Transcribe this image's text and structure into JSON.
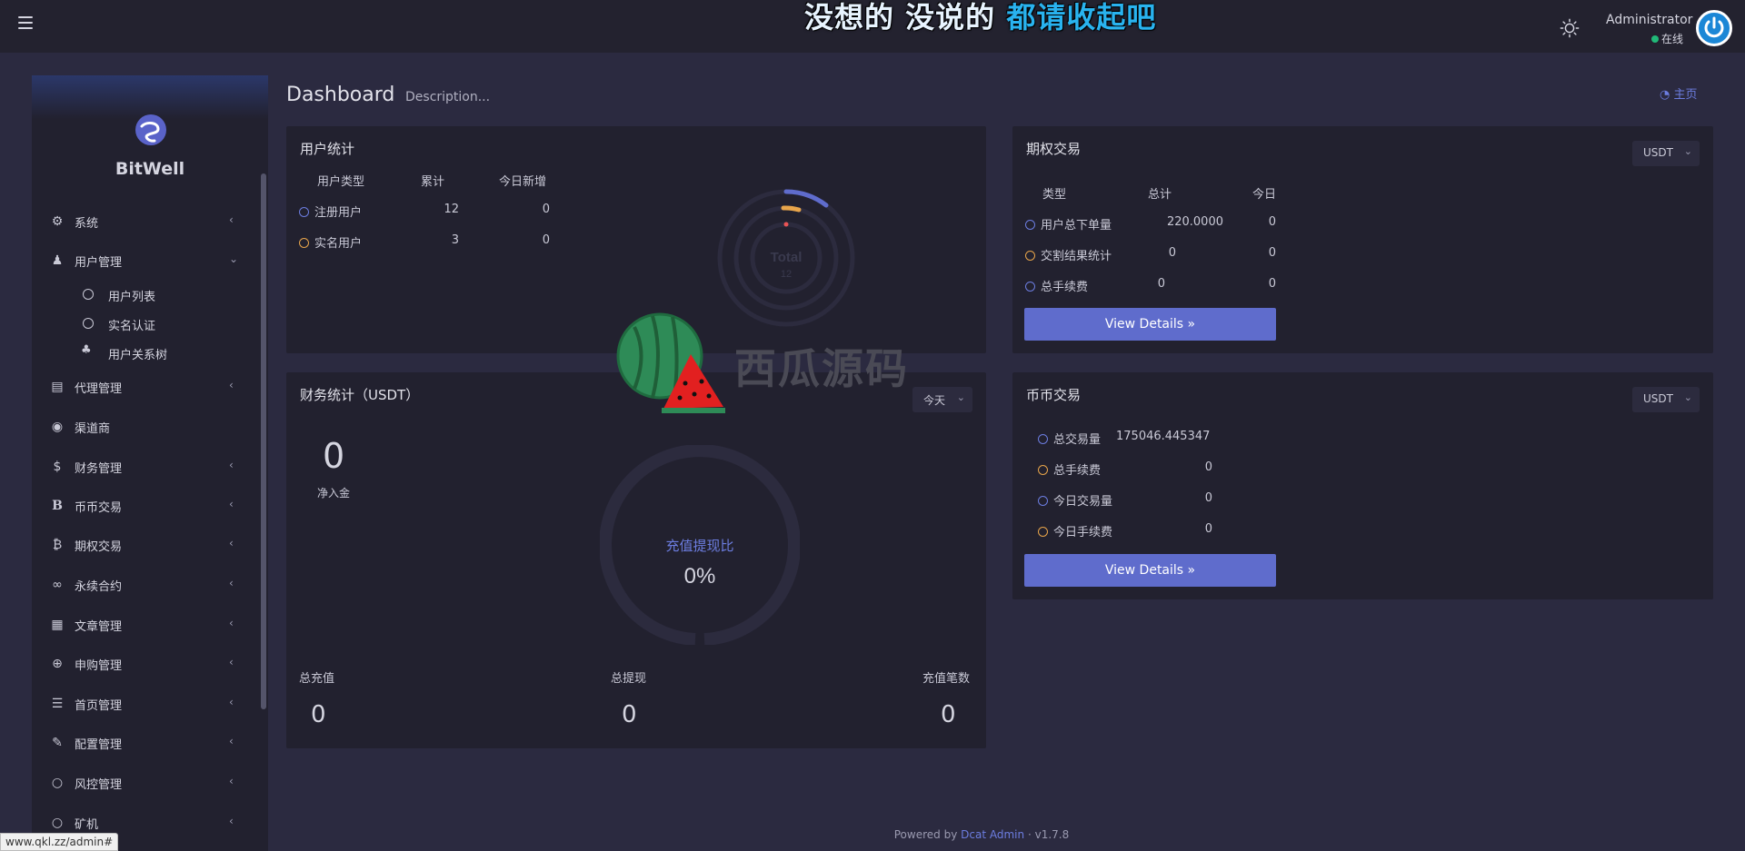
{
  "slogan": {
    "part1": "没想的",
    "part2": "没说的",
    "part3": "都请收起吧"
  },
  "header": {
    "user_name": "Administrator",
    "user_status": "在线"
  },
  "sidebar": {
    "brand": "BitWell",
    "items": [
      {
        "label": "系统",
        "icon": "gear-icon",
        "arrow": "‹"
      },
      {
        "label": "用户管理",
        "icon": "users-icon",
        "arrow": "⌄"
      },
      {
        "label": "代理管理",
        "icon": "id-card-icon",
        "arrow": "‹"
      },
      {
        "label": "渠道商",
        "icon": "user-circle-icon",
        "arrow": ""
      },
      {
        "label": "财务管理",
        "icon": "dollar-icon",
        "arrow": "‹"
      },
      {
        "label": "币币交易",
        "icon": "b-letter-icon",
        "arrow": "‹"
      },
      {
        "label": "期权交易",
        "icon": "bitcoin-icon",
        "arrow": "‹"
      },
      {
        "label": "永续合约",
        "icon": "link-icon",
        "arrow": "‹"
      },
      {
        "label": "文章管理",
        "icon": "newspaper-icon",
        "arrow": "‹"
      },
      {
        "label": "申购管理",
        "icon": "lifebuoy-icon",
        "arrow": "‹"
      },
      {
        "label": "首页管理",
        "icon": "list-icon",
        "arrow": "‹"
      },
      {
        "label": "配置管理",
        "icon": "wrench-icon",
        "arrow": "‹"
      },
      {
        "label": "风控管理",
        "icon": "circle-icon",
        "arrow": "‹"
      },
      {
        "label": "矿机",
        "icon": "circle-icon",
        "arrow": "‹"
      }
    ],
    "subitems": [
      {
        "label": "用户列表"
      },
      {
        "label": "实名认证"
      },
      {
        "label": "用户关系树"
      }
    ]
  },
  "page": {
    "title": "Dashboard",
    "description": "Description...",
    "home_link": "主页"
  },
  "user_stats": {
    "title": "用户统计",
    "headers": [
      "用户类型",
      "累计",
      "今日新增"
    ],
    "rows": [
      {
        "label": "注册用户",
        "total": "12",
        "today": "0"
      },
      {
        "label": "实名用户",
        "total": "3",
        "today": "0"
      }
    ],
    "donut_label": "Total",
    "donut_value": "12"
  },
  "options_trade": {
    "title": "期权交易",
    "currency": "USDT",
    "headers": [
      "类型",
      "总计",
      "今日"
    ],
    "rows": [
      {
        "label": "用户总下单量",
        "total": "220.0000",
        "today": "0"
      },
      {
        "label": "交割结果统计",
        "total": "0",
        "today": "0"
      },
      {
        "label": "总手续费",
        "total": "0",
        "today": "0"
      }
    ],
    "button": "View Details"
  },
  "finance": {
    "title": "财务统计（USDT）",
    "period": "今天",
    "net_value": "0",
    "net_label": "净入金",
    "ratio_label": "充值提现比",
    "ratio_value": "0%",
    "totals": [
      {
        "label": "总充值",
        "value": "0"
      },
      {
        "label": "总提现",
        "value": "0"
      },
      {
        "label": "充值笔数",
        "value": "0"
      }
    ]
  },
  "coin_trade": {
    "title": "币币交易",
    "currency": "USDT",
    "rows": [
      {
        "label": "总交易量",
        "value": "175046.445347",
        "color": "blue"
      },
      {
        "label": "总手续费",
        "value": "0",
        "color": "orange"
      },
      {
        "label": "今日交易量",
        "value": "0",
        "color": "blue"
      },
      {
        "label": "今日手续费",
        "value": "0",
        "color": "orange"
      }
    ],
    "button": "View Details"
  },
  "footer": {
    "powered_by": "Powered by",
    "link": "Dcat Admin",
    "sep": "·",
    "version": "v1.7.8"
  },
  "status_url": "www.qkl.zz/admin#",
  "watermark": "西瓜源码",
  "colors": {
    "accent": "#5f6ccc",
    "blue": "#6c7de0",
    "orange": "#e8a54b",
    "online": "#21b978"
  }
}
